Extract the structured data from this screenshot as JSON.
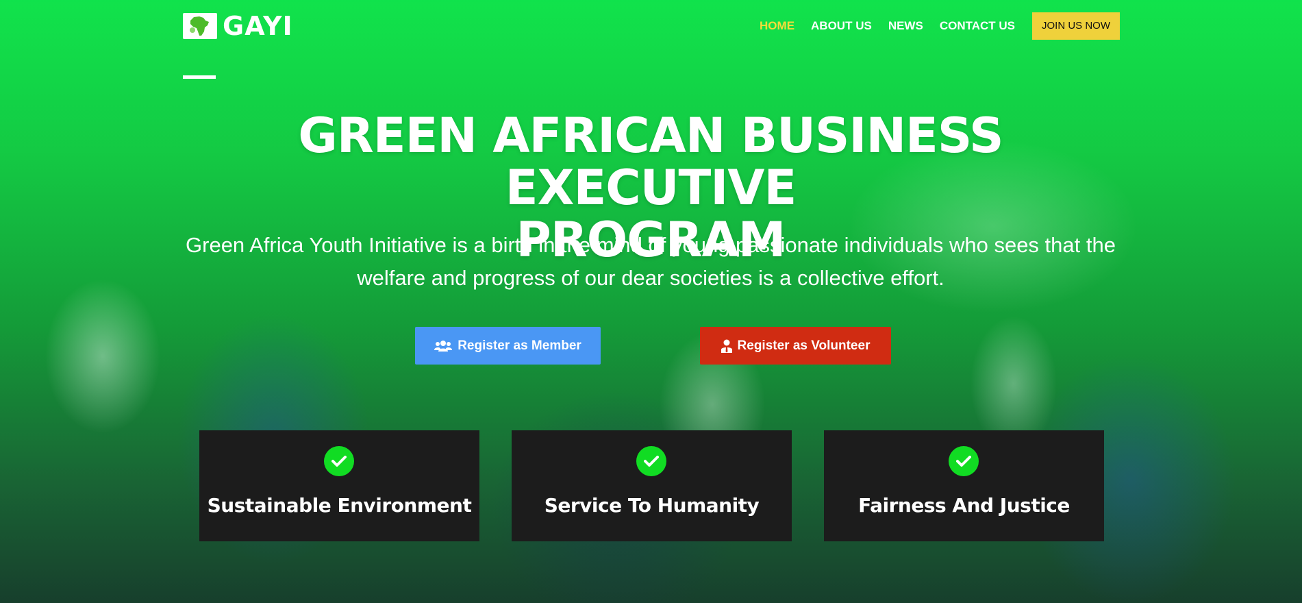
{
  "header": {
    "logo_text": "GAYI",
    "nav": [
      {
        "label": "HOME",
        "active": true
      },
      {
        "label": "ABOUT US",
        "active": false
      },
      {
        "label": "NEWS",
        "active": false
      },
      {
        "label": "CONTACT US",
        "active": false
      }
    ],
    "join_label": "JOIN US NOW"
  },
  "hero": {
    "title_line1": "GREEN AFRICAN BUSINESS EXECUTIVE",
    "title_line2": "PROGRAM",
    "subtitle_line1": "Green Africa Youth Initiative is a birth in the mind of young passionate individuals who sees that the",
    "subtitle_line2": "welfare and progress of our dear societies is a collective effort."
  },
  "buttons": {
    "member": {
      "label": "Register as Member",
      "icon": "users-icon"
    },
    "volunteer": {
      "label": "Register as Volunteer",
      "icon": "user-tie-icon"
    }
  },
  "values": [
    {
      "title": "Sustainable Environment",
      "icon": "check-circle-icon"
    },
    {
      "title": "Service To Humanity",
      "icon": "check-circle-icon"
    },
    {
      "title": "Fairness And Justice",
      "icon": "check-circle-icon"
    }
  ],
  "colors": {
    "accent_yellow": "#efd13b",
    "nav_active": "#f5dc3a",
    "member_blue": "#4a97f4",
    "volunteer_red": "#d02c12",
    "check_green": "#11dc23",
    "card_bg": "#1c1c1c"
  }
}
